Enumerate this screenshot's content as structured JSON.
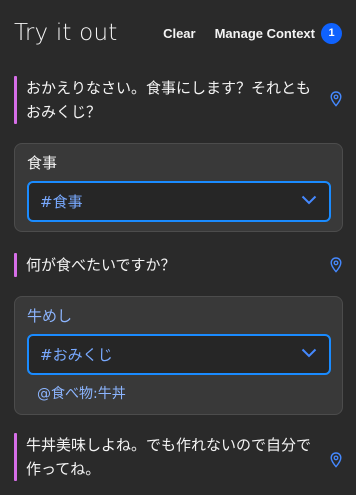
{
  "header": {
    "title": "Try it out",
    "clear_label": "Clear",
    "manage_context_label": "Manage Context",
    "context_count": "1"
  },
  "messages": [
    {
      "text": "おかえりなさい。食事にします？それともおみくじ？"
    },
    {
      "text": "何が食べたいですか？"
    },
    {
      "text": "牛丼美味しよね。でも作れないので自分で作ってね。"
    }
  ],
  "cards": [
    {
      "title": "食事",
      "selected": "#食事"
    },
    {
      "title": "牛めし",
      "selected": "#おみくじ",
      "entity": "@食べ物:牛丼"
    }
  ],
  "colors": {
    "accent": "#0f62fe",
    "bot_bar": "#d66ee8",
    "select_border": "#1a8bff",
    "intent_text": "#78a9ff"
  },
  "icons": {
    "message_pin": "location-pin-icon",
    "select_arrow": "chevron-down-icon"
  }
}
